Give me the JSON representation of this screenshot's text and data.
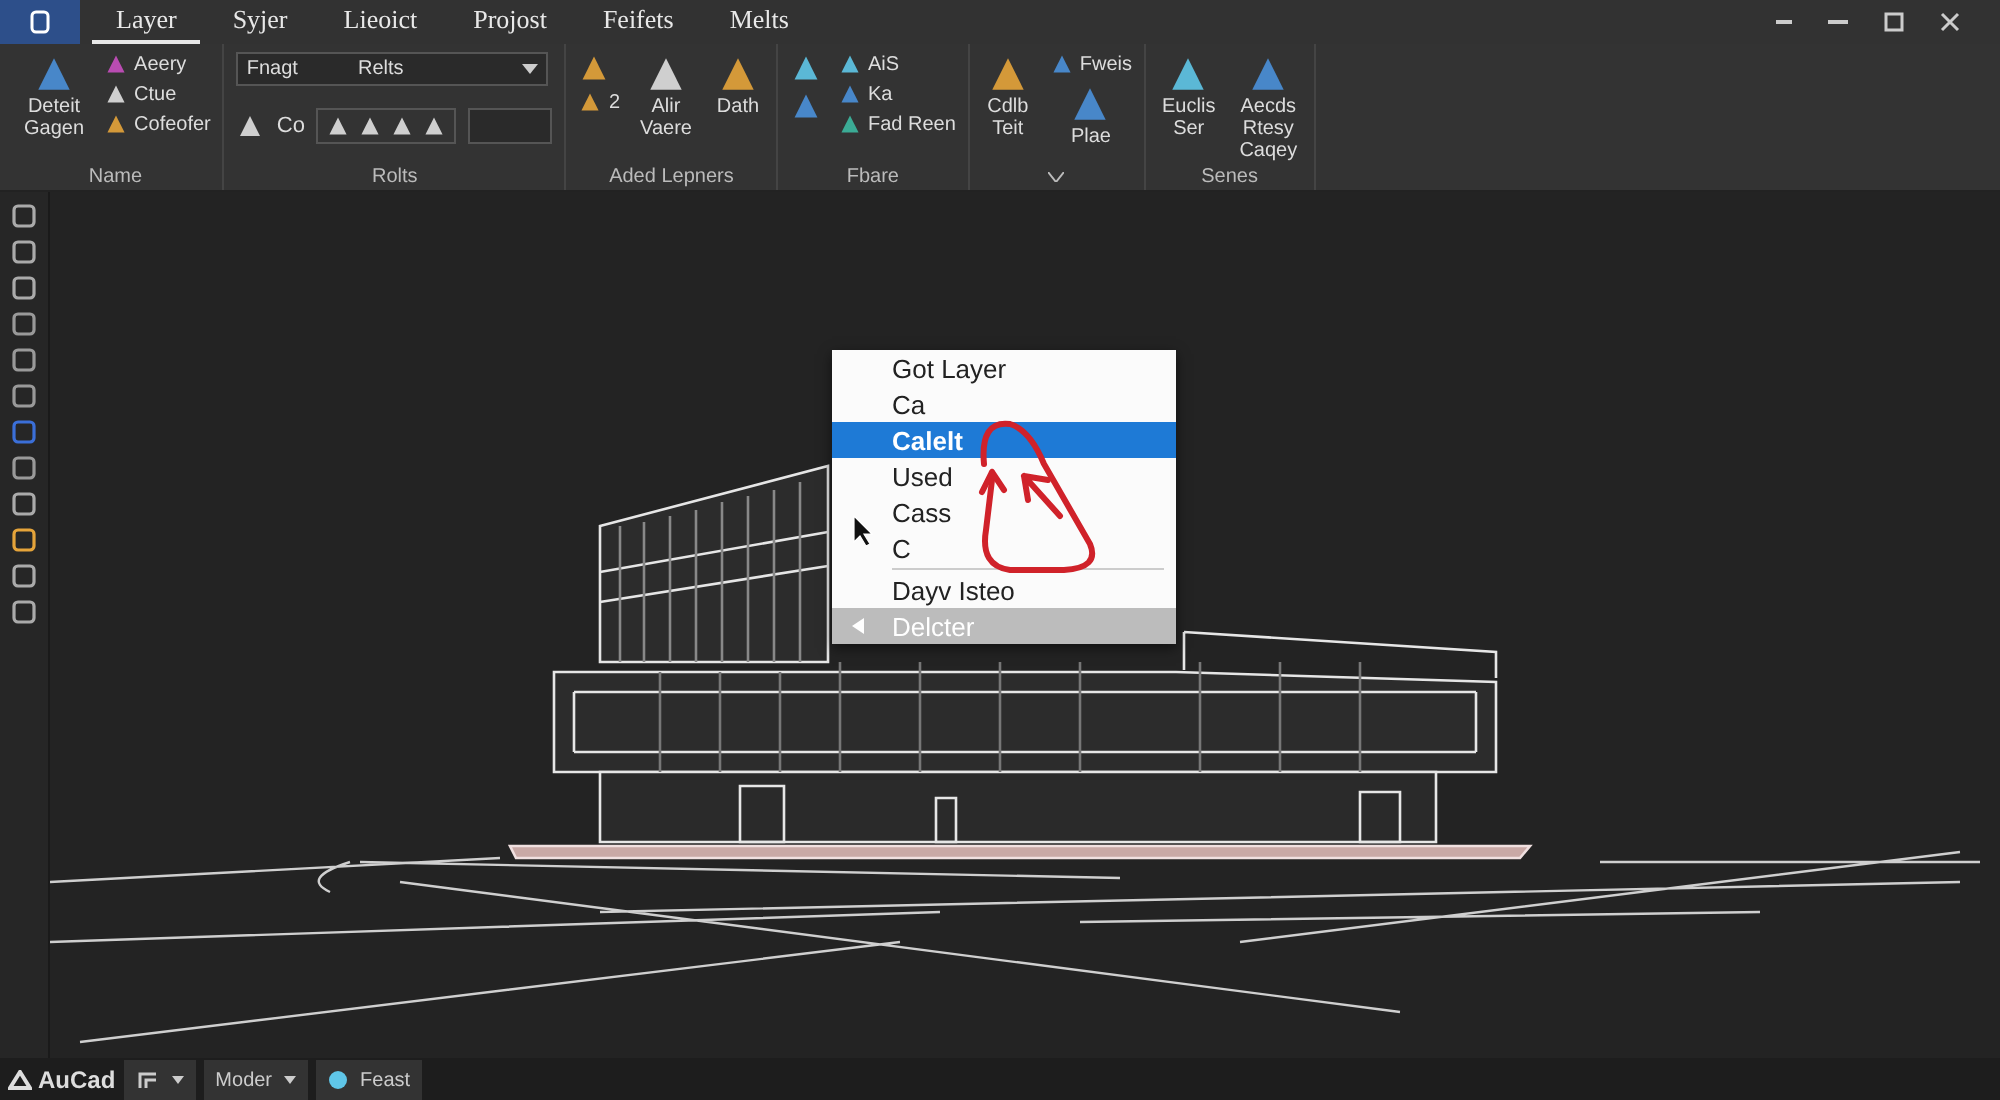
{
  "tabs": [
    {
      "label": "Layer",
      "selected": true
    },
    {
      "label": "Syjer",
      "selected": false
    },
    {
      "label": "Lieoict",
      "selected": false
    },
    {
      "label": "Projost",
      "selected": false
    },
    {
      "label": "Feifets",
      "selected": false
    },
    {
      "label": "Melts",
      "selected": false
    }
  ],
  "ribbon": {
    "groups": [
      {
        "label": "Name",
        "columns": [
          [
            {
              "kind": "large",
              "label": "Deteit\nGagen"
            }
          ],
          [
            {
              "kind": "small",
              "label": "Aeery"
            },
            {
              "kind": "small",
              "label": "Ctue"
            },
            {
              "kind": "small",
              "label": "Cofeofer"
            }
          ]
        ]
      },
      {
        "label": "Rolts",
        "columns": [
          [
            {
              "kind": "combo",
              "value": "Fnagt",
              "value2": "Relts"
            },
            {
              "kind": "toolrow",
              "label": "Co"
            }
          ]
        ]
      },
      {
        "label": "Aded Lepners",
        "columns": [
          [
            {
              "kind": "icon"
            },
            {
              "kind": "small",
              "label": "2"
            }
          ],
          [
            {
              "kind": "large",
              "label": "Alir\nVaere"
            }
          ],
          [
            {
              "kind": "large",
              "label": "Dath"
            }
          ]
        ]
      },
      {
        "label": "Fbare",
        "columns": [
          [
            {
              "kind": "icon"
            },
            {
              "kind": "icon"
            }
          ],
          [
            {
              "kind": "small",
              "label": "AiS"
            },
            {
              "kind": "small",
              "label": "Ka"
            },
            {
              "kind": "small",
              "label": "Fad Reen"
            }
          ]
        ]
      },
      {
        "columns": [
          [
            {
              "kind": "large",
              "label": "Cdlb\nTeit"
            }
          ],
          [
            {
              "kind": "small",
              "label": "Fweis"
            },
            {
              "kind": "large",
              "label": "Plae"
            }
          ]
        ]
      },
      {
        "label": "Senes",
        "columns": [
          [
            {
              "kind": "large",
              "label": "Euclis\nSer"
            }
          ],
          [
            {
              "kind": "large",
              "label": "Aecds\nRtesy\nCaqey"
            }
          ]
        ]
      }
    ]
  },
  "context_menu": {
    "items": [
      {
        "kind": "item",
        "label": "Got Layer",
        "selected": false
      },
      {
        "kind": "item",
        "label": "Ca",
        "selected": false
      },
      {
        "kind": "item",
        "label": "Calelt",
        "selected": true
      },
      {
        "kind": "item",
        "label": "Used",
        "selected": false
      },
      {
        "kind": "item",
        "label": "Cass",
        "selected": false
      },
      {
        "kind": "item",
        "label": "C",
        "selected": false
      },
      {
        "kind": "separator"
      },
      {
        "kind": "item",
        "label": "Dayv Isteo",
        "selected": false
      },
      {
        "kind": "footer",
        "label": "Delcter",
        "selected": false
      }
    ]
  },
  "status_bar": {
    "items": [
      {
        "kind": "brand",
        "label": "AuCad"
      },
      {
        "kind": "iconbutton"
      },
      {
        "kind": "dropdown",
        "label": "Moder"
      },
      {
        "kind": "tag",
        "label": "Feast"
      }
    ]
  }
}
